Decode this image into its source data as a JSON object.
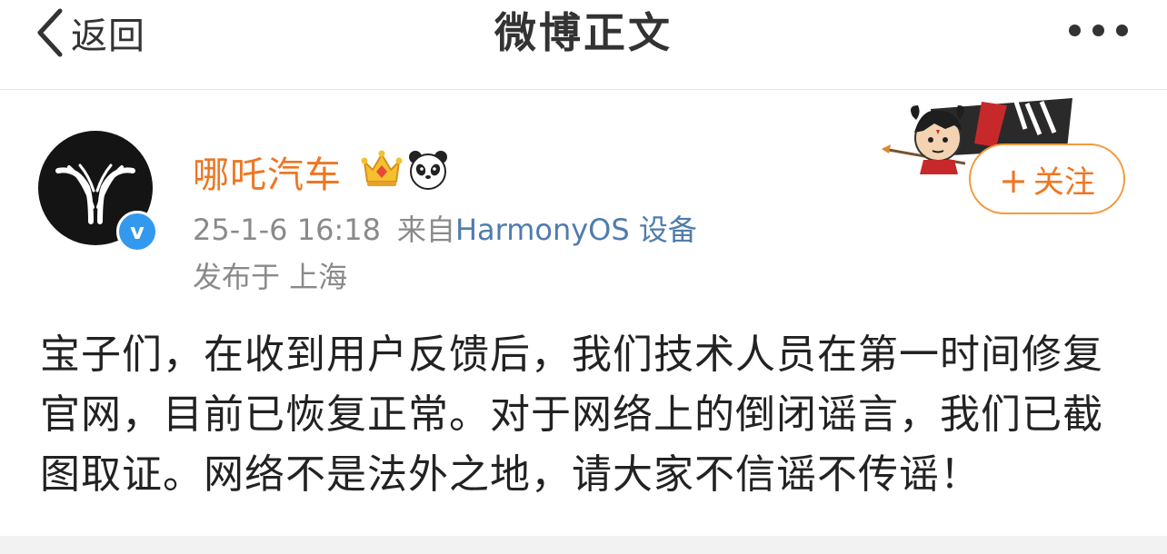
{
  "nav": {
    "back_label": "返回",
    "title": "微博正文",
    "more_icon": "more-dots-icon"
  },
  "post": {
    "author_name": "哪吒汽车",
    "verified_mark": "v",
    "timestamp": "25-1-6 16:18",
    "source_prefix": "来自",
    "source_device": "HarmonyOS 设备",
    "location": "发布于 上海",
    "follow_label": "关注",
    "follow_plus": "+",
    "text": "宝子们，在收到用户反馈后，我们技术人员在第一时间修复官网，目前已恢复正常。对于网络上的倒闭谣言，我们已截图取证。网络不是法外之地，请大家不信谣不传谣！"
  },
  "colors": {
    "username": "#ef7622",
    "follow_border": "#f39a3a",
    "link": "#4f7cad",
    "verified": "#3399ee",
    "meta": "#8a8a8a"
  }
}
